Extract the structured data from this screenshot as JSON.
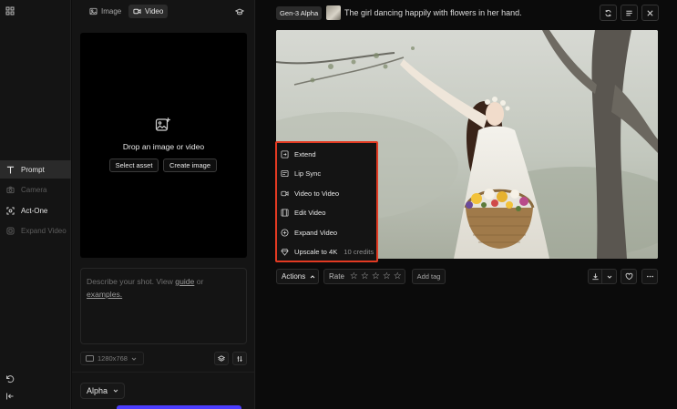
{
  "rail": {
    "items": [
      {
        "label": "Prompt"
      },
      {
        "label": "Camera"
      },
      {
        "label": "Act-One"
      },
      {
        "label": "Expand Video"
      }
    ]
  },
  "mode_tabs": [
    {
      "label": "Image"
    },
    {
      "label": "Video"
    }
  ],
  "drop_zone": {
    "label": "Drop an image or video",
    "select_asset": "Select asset",
    "create_image": "Create image"
  },
  "prompt": {
    "placeholder_start": "Describe your shot. View",
    "guide_link": "guide",
    "or": "or",
    "examples_link": "examples."
  },
  "settings": {
    "resolution": "1280x768",
    "model": "Alpha"
  },
  "result": {
    "model_badge": "Gen-3 Alpha",
    "title": "The girl dancing happily with flowers in her hand."
  },
  "actions_menu": {
    "items": [
      {
        "label": "Extend",
        "icon": "extend-icon"
      },
      {
        "label": "Lip Sync",
        "icon": "lip-sync-icon"
      },
      {
        "label": "Video to Video",
        "icon": "video-camera-icon"
      },
      {
        "label": "Edit Video",
        "icon": "edit-video-icon"
      },
      {
        "label": "Expand Video",
        "icon": "expand-icon"
      },
      {
        "label": "Upscale to 4K",
        "icon": "diamond-icon",
        "credits": "10 credits"
      }
    ]
  },
  "toolbar": {
    "actions_label": "Actions",
    "rate_label": "Rate",
    "add_tag_label": "Add tag"
  },
  "colors": {
    "highlight": "#e23a22",
    "generate": "#4b3dff"
  }
}
